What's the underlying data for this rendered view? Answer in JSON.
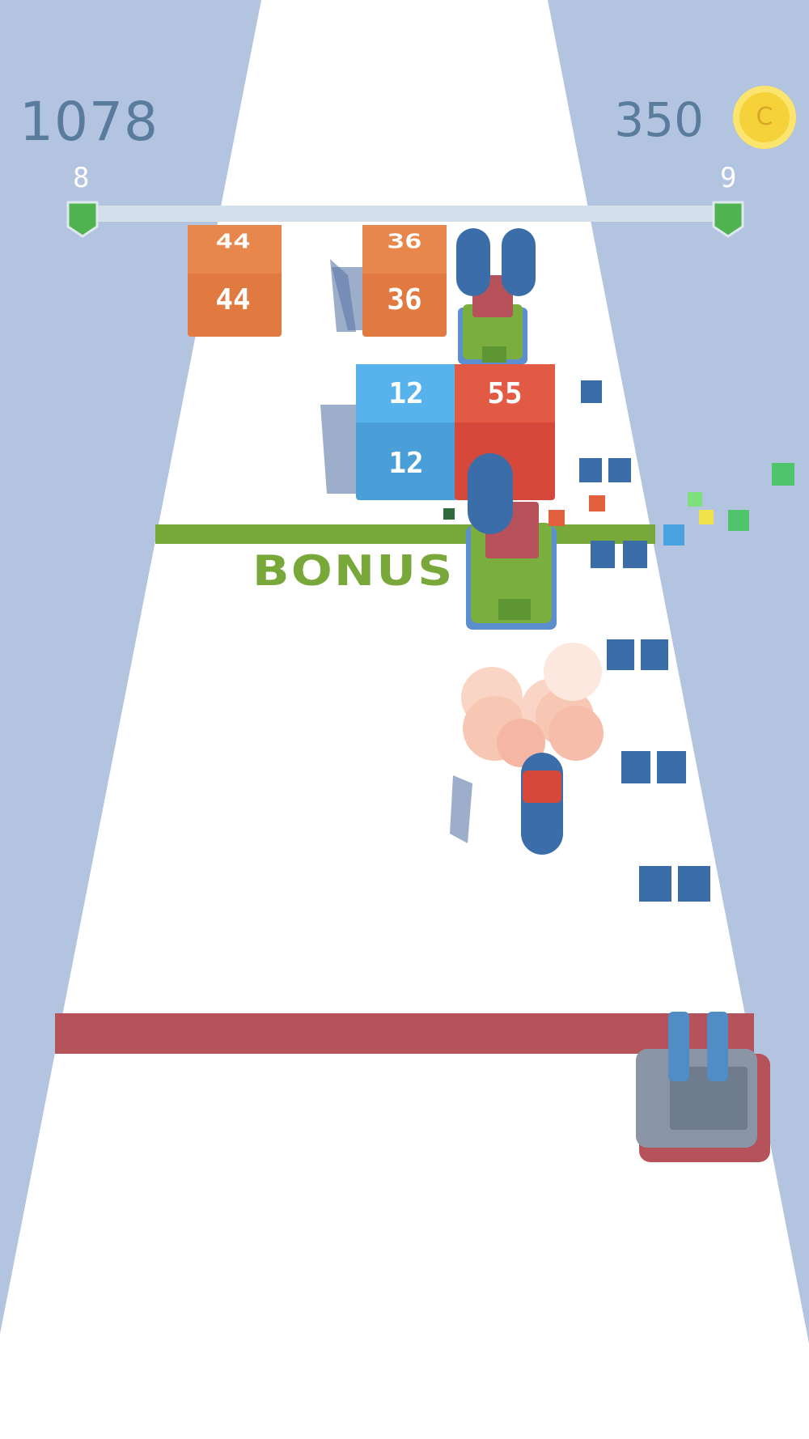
{
  "hud": {
    "score": "1078",
    "coins": "350",
    "coin_symbol": "C",
    "level_current": "8",
    "level_next": "9"
  },
  "track": {
    "bonus_label": "BONUS"
  },
  "cubes": {
    "orange_left": "44",
    "orange_mid": "36",
    "blue": "12",
    "red": "55"
  },
  "colors": {
    "background": "#b3c4e0",
    "road": "#ffffff",
    "bonus_line": "#78a83a",
    "red_line": "#b5525a",
    "progress_bar": "#d3e0ec",
    "progress_flag": "#4fb34f"
  }
}
